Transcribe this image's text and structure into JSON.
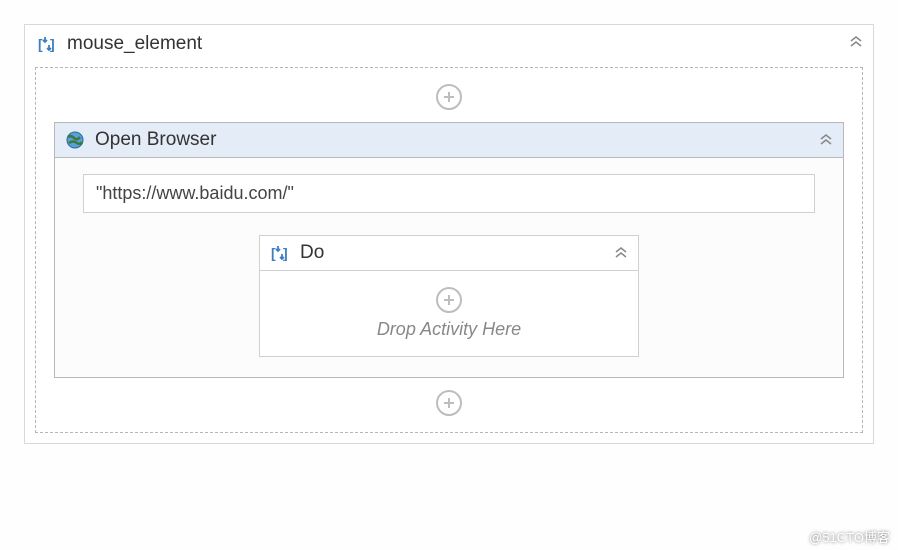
{
  "outer": {
    "title": "mouse_element"
  },
  "openBrowser": {
    "title": "Open Browser",
    "url": "\"https://www.baidu.com/\""
  },
  "doBlock": {
    "title": "Do",
    "placeholder": "Drop Activity Here"
  },
  "watermark": "@51CTO博客"
}
